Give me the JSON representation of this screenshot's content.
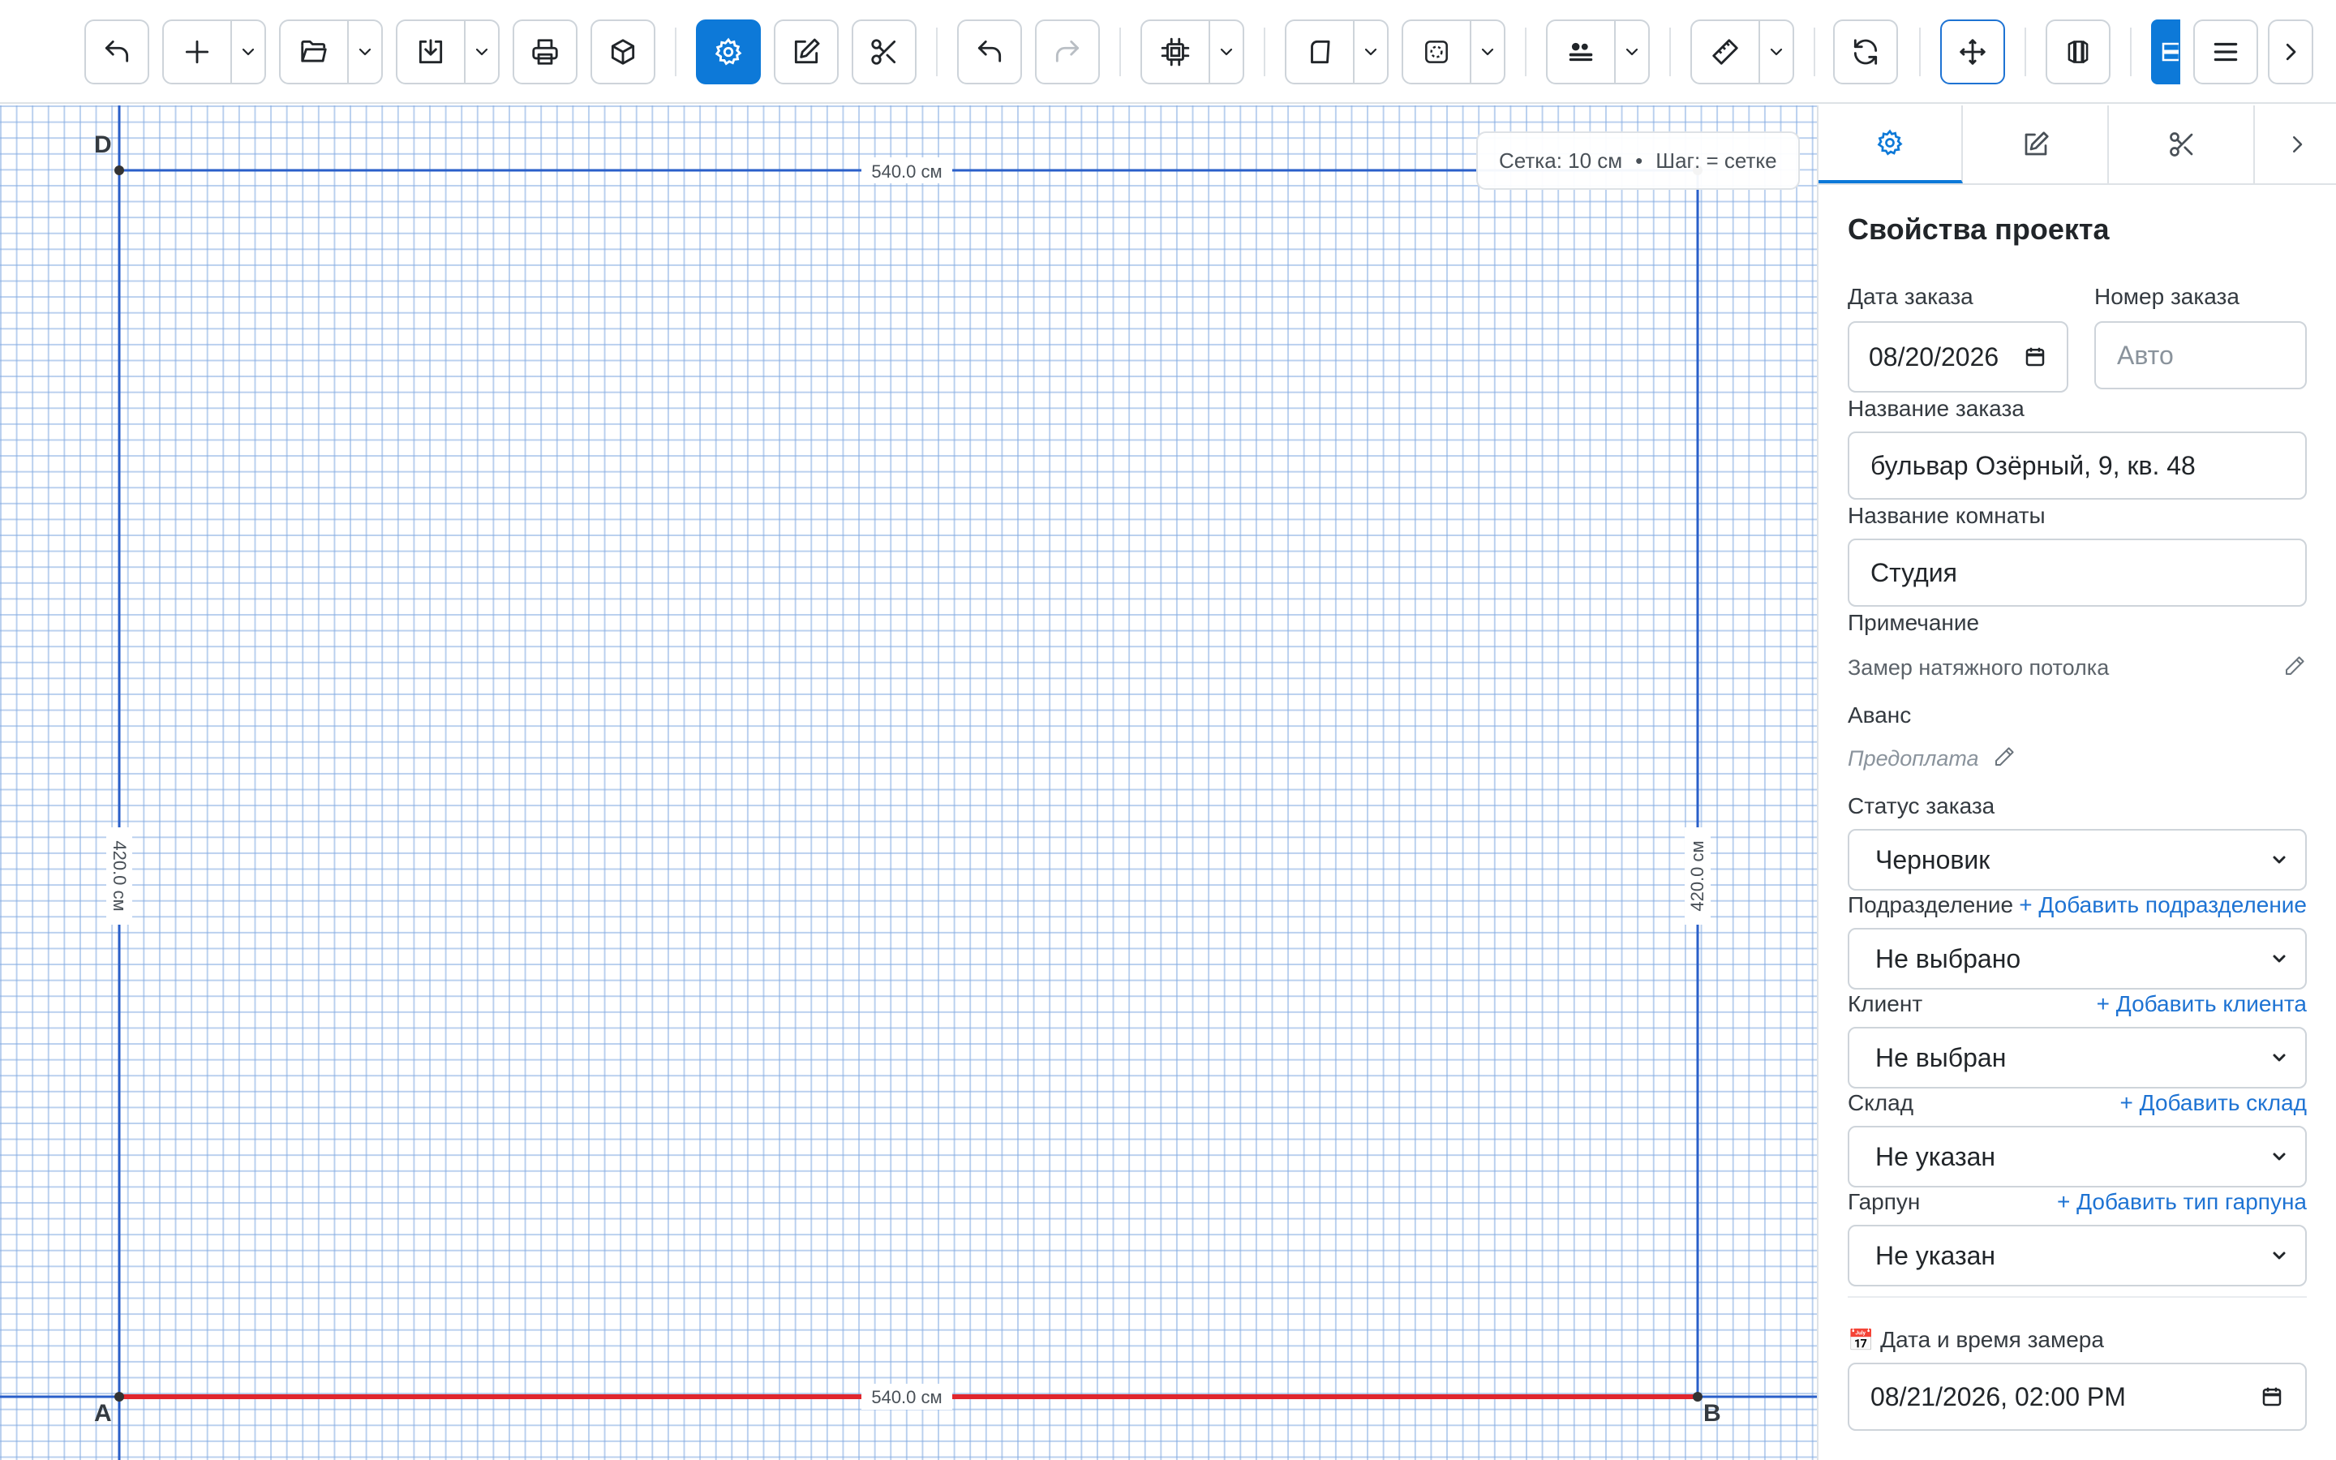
{
  "canvas": {
    "grid_info": "Сетка: 10 см",
    "grid_bullet": "•",
    "step_info": "Шаг: = сетке",
    "points": [
      {
        "label": "D"
      },
      {
        "label": "A"
      },
      {
        "label": "B"
      }
    ],
    "dimensions": {
      "top": "540.0 см",
      "bottom": "540.0 см",
      "left": "420.0 см",
      "right": "420.0 см"
    },
    "colors": {
      "wall": "#2a5fc9",
      "selected_wall": "#e0262d",
      "point": "#333333"
    }
  },
  "panel": {
    "title": "Свойства проекта",
    "order_date_label": "Дата заказа",
    "order_date_value": "08/20/2026",
    "order_number_label": "Номер заказа",
    "order_number_placeholder": "Авто",
    "order_name_label": "Название заказа",
    "order_name_value": "бульвар Озёрный, 9, кв. 48",
    "room_name_label": "Название комнаты",
    "room_name_value": "Студия",
    "note_label": "Примечание",
    "note_value": "Замер натяжного потолка",
    "advance_label": "Аванс",
    "advance_placeholder": "Предоплата",
    "status_label": "Статус заказа",
    "status_value": "Черновик",
    "division_label": "Подразделение",
    "division_add": "+ Добавить подразделение",
    "division_value": "Не выбрано",
    "client_label": "Клиент",
    "client_add": "+ Добавить клиента",
    "client_value": "Не выбран",
    "warehouse_label": "Склад",
    "warehouse_add": "+ Добавить склад",
    "warehouse_value": "Не указан",
    "harpoon_label": "Гарпун",
    "harpoon_add": "+ Добавить тип гарпуна",
    "harpoon_value": "Не указан",
    "measure_icon": "📅",
    "measure_label": "Дата и время замера",
    "measure_value": "08/21/2026, 02:00 PM"
  },
  "icons": {
    "toolbar": [
      "back-arrow-icon",
      "plus-icon",
      "folder-open-icon",
      "download-icon",
      "printer-icon",
      "cube-icon",
      "gear-icon",
      "edit-icon",
      "scissors-icon",
      "undo-icon",
      "redo-icon",
      "chip-icon",
      "corner-icon",
      "area-icon",
      "align-icon",
      "ruler-icon",
      "refresh-icon",
      "crosshair-icon",
      "panels-icon",
      "layout-icon",
      "menu-icon",
      "chevron-right-icon"
    ]
  }
}
